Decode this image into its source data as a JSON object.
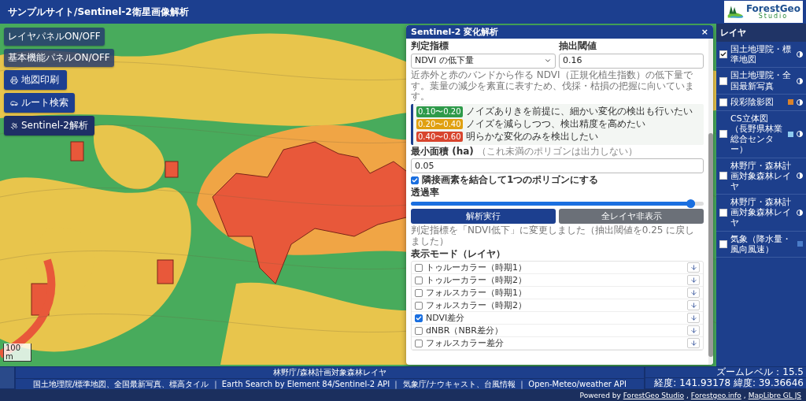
{
  "header": {
    "title": "サンプルサイト/Sentinel-2衛星画像解析",
    "logo": {
      "name": "ForestGeo",
      "sub": "Studio"
    }
  },
  "map_buttons": [
    {
      "label": "レイヤパネルON/OFF",
      "kind": "toggle"
    },
    {
      "label": "基本機能パネルON/OFF",
      "kind": "toggle"
    },
    {
      "label": "地図印刷",
      "kind": "print"
    },
    {
      "label": "ルート検索",
      "kind": "route"
    },
    {
      "label": "Sentinel-2解析",
      "kind": "satellite"
    }
  ],
  "scale": "100 m",
  "panel": {
    "title": "Sentinel-2 変化解析",
    "close": "×",
    "index": {
      "label": "判定指標",
      "value": "NDVI の低下量"
    },
    "threshold": {
      "label": "抽出閾値",
      "value": "0.16"
    },
    "description": "近赤外と赤のバンドから作る NDVI（正規化植生指数）の低下量です。葉量の減少を素直に表すため、伐採・枯損の把握に向いています。",
    "guide": [
      {
        "range": "0.10〜0.20",
        "text": "ノイズありきを前提に、細かい変化の検出も行いたい",
        "color": "#2e9a4a"
      },
      {
        "range": "0.20〜0.40",
        "text": "ノイズを減らしつつ、検出精度を高めたい",
        "color": "#e0a010"
      },
      {
        "range": "0.40〜0.60",
        "text": "明らかな変化のみを検出したい",
        "color": "#d8452e"
      }
    ],
    "min_area": {
      "label": "最小面積 (ha)",
      "hint": "（これ未満のポリゴンは出力しない）",
      "value": "0.05"
    },
    "merge": {
      "label": "隣接画素を結合して1つのポリゴンにする",
      "checked": true
    },
    "opacity": {
      "label": "透過率",
      "level": 0.97
    },
    "buttons": [
      {
        "label": "解析実行",
        "kind": "primary"
      },
      {
        "label": "全レイヤ非表示",
        "kind": "secondary"
      }
    ],
    "status": "判定指標を「NDVI低下」に変更しました（抽出閾値を0.25 に戻しました）",
    "modes_title": "表示モード（レイヤ）",
    "modes": [
      {
        "label": "トゥルーカラー（時期1）",
        "checked": false
      },
      {
        "label": "トゥルーカラー（時期2）",
        "checked": false
      },
      {
        "label": "フォルスカラー（時期1）",
        "checked": false
      },
      {
        "label": "フォルスカラー（時期2）",
        "checked": false
      },
      {
        "label": "NDVI差分",
        "checked": true
      },
      {
        "label": "dNBR（NBR差分）",
        "checked": false
      },
      {
        "label": "フォルスカラー差分",
        "checked": false
      }
    ]
  },
  "layers": {
    "title": "レイヤ",
    "items": [
      {
        "label": "国土地理院・標準地図",
        "checked": true,
        "opacity_control": true
      },
      {
        "label": "国土地理院・全国最新写真",
        "checked": false,
        "opacity_control": true
      },
      {
        "label": "段彩陰影図",
        "checked": false,
        "color": "#d9822b",
        "opacity_control": true
      },
      {
        "label": "CS立体図（長野県林業総合センター）",
        "checked": false,
        "color": "#8ecbf0",
        "opacity_control": true
      },
      {
        "label": "林野庁・森林計画対象森林レイヤ",
        "checked": false,
        "opacity_control": true
      },
      {
        "label": "林野庁・森林計画対象森林レイヤ",
        "checked": false,
        "opacity_control": true
      },
      {
        "label": "気象（降水量・風向風速）",
        "checked": false,
        "color": "#4a7cc8",
        "opacity_control": false
      }
    ]
  },
  "footer": {
    "lines": [
      "林野庁/森林計画対象森林レイヤ",
      "国土地理院/標準地図、全国最新写真、標高タイル ｜ Earth Search by Element 84/Sentinel-2 API ｜ 気象庁/ナウキャスト、台風情報 ｜ Open-Meteo/weather API"
    ],
    "zoom": "ズームレベル：15.5",
    "coords": "経度: 141.93178 緯度: 39.36646"
  },
  "credits": {
    "prefix": "Powered by",
    "links": [
      {
        "text": "ForestGeo Studio",
        "sep": ","
      },
      {
        "text": "Forestgeo.info",
        "sep": ","
      },
      {
        "text": "MapLibre GL JS"
      }
    ]
  }
}
